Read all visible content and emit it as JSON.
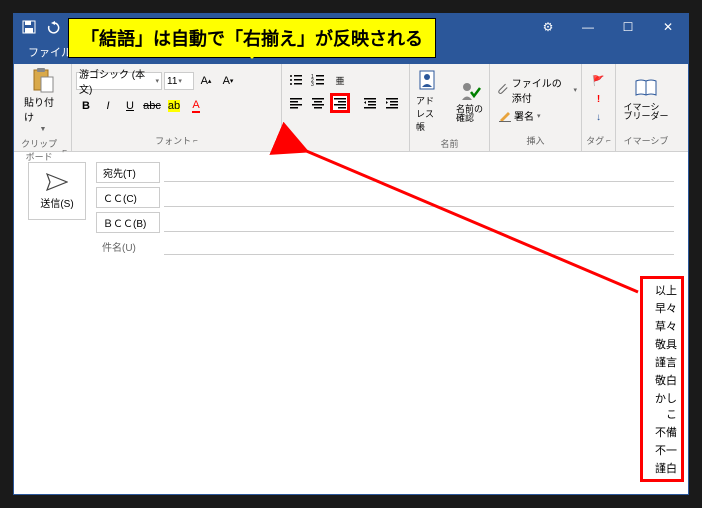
{
  "callout": "「結語」は自動で「右揃え」が反映される",
  "menubar": {
    "file": "ファイル"
  },
  "ribbon": {
    "clipboard": {
      "paste": "貼り付け",
      "label": "クリップボード"
    },
    "font": {
      "name": "游ゴシック (本文)",
      "size": "11",
      "bold": "B",
      "italic": "I",
      "underline": "U",
      "label": "フォント"
    },
    "names": {
      "address_book": "アドレス帳",
      "check_names": "名前の\n確認",
      "label": "名前"
    },
    "insert": {
      "attach_file": "ファイルの添付",
      "signature": "署名",
      "label": "挿入"
    },
    "tags": {
      "label": "タグ"
    },
    "immersive": {
      "reader": "イマーシ\nブリーダー",
      "label": "イマーシブ"
    }
  },
  "compose": {
    "send": "送信(S)",
    "to": "宛先(T)",
    "cc": "ＣＣ(C)",
    "bcc": "ＢＣＣ(B)",
    "subject": "件名(U)"
  },
  "candidates": [
    "以上",
    "早々",
    "草々",
    "敬具",
    "謹言",
    "敬白",
    "かしこ",
    "不備",
    "不一",
    "謹白"
  ]
}
